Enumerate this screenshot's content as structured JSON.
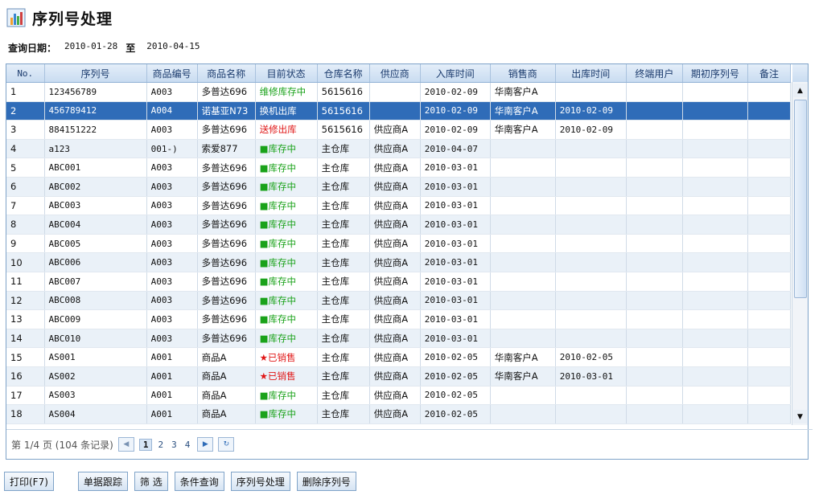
{
  "page": {
    "title": "序列号处理"
  },
  "query": {
    "label": "查询日期：",
    "from": "2010-01-28",
    "to_label": "至",
    "to": "2010-04-15"
  },
  "columns": [
    "No.",
    "序列号",
    "商品编号",
    "商品名称",
    "目前状态",
    "仓库名称",
    "供应商",
    "入库时间",
    "销售商",
    "出库时间",
    "终端用户",
    "期初序列号",
    "备注"
  ],
  "rows": [
    {
      "no": "1",
      "serial": "123456789",
      "code": "A003",
      "name": "多普达696",
      "status": "维修库存中",
      "status_color": "green",
      "wh": "5615616",
      "supplier": "",
      "in_date": "2010-02-09",
      "seller": "华南客户A",
      "out_date": "",
      "end_user": "",
      "init_serial": "",
      "note": ""
    },
    {
      "no": "2",
      "serial": "456789412",
      "code": "A004",
      "name": "诺基亚N73",
      "status": "换机出库",
      "status_color": "green",
      "wh": "5615616",
      "supplier": "",
      "in_date": "2010-02-09",
      "seller": "华南客户A",
      "out_date": "2010-02-09",
      "end_user": "",
      "init_serial": "",
      "note": "",
      "selected": true
    },
    {
      "no": "3",
      "serial": "884151222",
      "code": "A003",
      "name": "多普达696",
      "status": "送修出库",
      "status_color": "red",
      "wh": "5615616",
      "supplier": "供应商A",
      "in_date": "2010-02-09",
      "seller": "华南客户A",
      "out_date": "2010-02-09",
      "end_user": "",
      "init_serial": "",
      "note": ""
    },
    {
      "no": "4",
      "serial": "a123",
      "code": "001-)",
      "name": "索爱877",
      "status": "■库存中",
      "status_color": "green",
      "wh": "主仓库",
      "supplier": "供应商A",
      "in_date": "2010-04-07",
      "seller": "",
      "out_date": "",
      "end_user": "",
      "init_serial": "",
      "note": ""
    },
    {
      "no": "5",
      "serial": "ABC001",
      "code": "A003",
      "name": "多普达696",
      "status": "■库存中",
      "status_color": "green",
      "wh": "主仓库",
      "supplier": "供应商A",
      "in_date": "2010-03-01",
      "seller": "",
      "out_date": "",
      "end_user": "",
      "init_serial": "",
      "note": ""
    },
    {
      "no": "6",
      "serial": "ABC002",
      "code": "A003",
      "name": "多普达696",
      "status": "■库存中",
      "status_color": "green",
      "wh": "主仓库",
      "supplier": "供应商A",
      "in_date": "2010-03-01",
      "seller": "",
      "out_date": "",
      "end_user": "",
      "init_serial": "",
      "note": ""
    },
    {
      "no": "7",
      "serial": "ABC003",
      "code": "A003",
      "name": "多普达696",
      "status": "■库存中",
      "status_color": "green",
      "wh": "主仓库",
      "supplier": "供应商A",
      "in_date": "2010-03-01",
      "seller": "",
      "out_date": "",
      "end_user": "",
      "init_serial": "",
      "note": ""
    },
    {
      "no": "8",
      "serial": "ABC004",
      "code": "A003",
      "name": "多普达696",
      "status": "■库存中",
      "status_color": "green",
      "wh": "主仓库",
      "supplier": "供应商A",
      "in_date": "2010-03-01",
      "seller": "",
      "out_date": "",
      "end_user": "",
      "init_serial": "",
      "note": ""
    },
    {
      "no": "9",
      "serial": "ABC005",
      "code": "A003",
      "name": "多普达696",
      "status": "■库存中",
      "status_color": "green",
      "wh": "主仓库",
      "supplier": "供应商A",
      "in_date": "2010-03-01",
      "seller": "",
      "out_date": "",
      "end_user": "",
      "init_serial": "",
      "note": ""
    },
    {
      "no": "10",
      "serial": "ABC006",
      "code": "A003",
      "name": "多普达696",
      "status": "■库存中",
      "status_color": "green",
      "wh": "主仓库",
      "supplier": "供应商A",
      "in_date": "2010-03-01",
      "seller": "",
      "out_date": "",
      "end_user": "",
      "init_serial": "",
      "note": ""
    },
    {
      "no": "11",
      "serial": "ABC007",
      "code": "A003",
      "name": "多普达696",
      "status": "■库存中",
      "status_color": "green",
      "wh": "主仓库",
      "supplier": "供应商A",
      "in_date": "2010-03-01",
      "seller": "",
      "out_date": "",
      "end_user": "",
      "init_serial": "",
      "note": ""
    },
    {
      "no": "12",
      "serial": "ABC008",
      "code": "A003",
      "name": "多普达696",
      "status": "■库存中",
      "status_color": "green",
      "wh": "主仓库",
      "supplier": "供应商A",
      "in_date": "2010-03-01",
      "seller": "",
      "out_date": "",
      "end_user": "",
      "init_serial": "",
      "note": ""
    },
    {
      "no": "13",
      "serial": "ABC009",
      "code": "A003",
      "name": "多普达696",
      "status": "■库存中",
      "status_color": "green",
      "wh": "主仓库",
      "supplier": "供应商A",
      "in_date": "2010-03-01",
      "seller": "",
      "out_date": "",
      "end_user": "",
      "init_serial": "",
      "note": ""
    },
    {
      "no": "14",
      "serial": "ABC010",
      "code": "A003",
      "name": "多普达696",
      "status": "■库存中",
      "status_color": "green",
      "wh": "主仓库",
      "supplier": "供应商A",
      "in_date": "2010-03-01",
      "seller": "",
      "out_date": "",
      "end_user": "",
      "init_serial": "",
      "note": ""
    },
    {
      "no": "15",
      "serial": "AS001",
      "code": "A001",
      "name": "商品A",
      "status": "★已销售",
      "status_color": "red",
      "wh": "主仓库",
      "supplier": "供应商A",
      "in_date": "2010-02-05",
      "seller": "华南客户A",
      "out_date": "2010-02-05",
      "end_user": "",
      "init_serial": "",
      "note": ""
    },
    {
      "no": "16",
      "serial": "AS002",
      "code": "A001",
      "name": "商品A",
      "status": "★已销售",
      "status_color": "red",
      "wh": "主仓库",
      "supplier": "供应商A",
      "in_date": "2010-02-05",
      "seller": "华南客户A",
      "out_date": "2010-03-01",
      "end_user": "",
      "init_serial": "",
      "note": ""
    },
    {
      "no": "17",
      "serial": "AS003",
      "code": "A001",
      "name": "商品A",
      "status": "■库存中",
      "status_color": "green",
      "wh": "主仓库",
      "supplier": "供应商A",
      "in_date": "2010-02-05",
      "seller": "",
      "out_date": "",
      "end_user": "",
      "init_serial": "",
      "note": ""
    },
    {
      "no": "18",
      "serial": "AS004",
      "code": "A001",
      "name": "商品A",
      "status": "■库存中",
      "status_color": "green",
      "wh": "主仓库",
      "supplier": "供应商A",
      "in_date": "2010-02-05",
      "seller": "",
      "out_date": "",
      "end_user": "",
      "init_serial": "",
      "note": ""
    }
  ],
  "pager": {
    "info": "第 1/4 页 (104 条记录)",
    "pages": [
      "1",
      "2",
      "3",
      "4"
    ],
    "current": "1"
  },
  "buttons": {
    "print": "打印(F7)",
    "track": "单据跟踪",
    "filter": "筛 选",
    "query": "条件查询",
    "serial": "序列号处理",
    "delete": "删除序列号"
  },
  "colors": {
    "header_text": "#1b3b6d",
    "selected_row": "#2f6cb8",
    "alt_row": "#eaf1f8",
    "status_green": "#1aa21a",
    "status_red": "#e01616"
  },
  "icons": {
    "title": "chart-icon",
    "scroll_up": "caret-up-icon",
    "scroll_down": "caret-down-icon",
    "prev": "chevron-left-icon",
    "next": "chevron-right-icon",
    "refresh": "refresh-icon"
  }
}
